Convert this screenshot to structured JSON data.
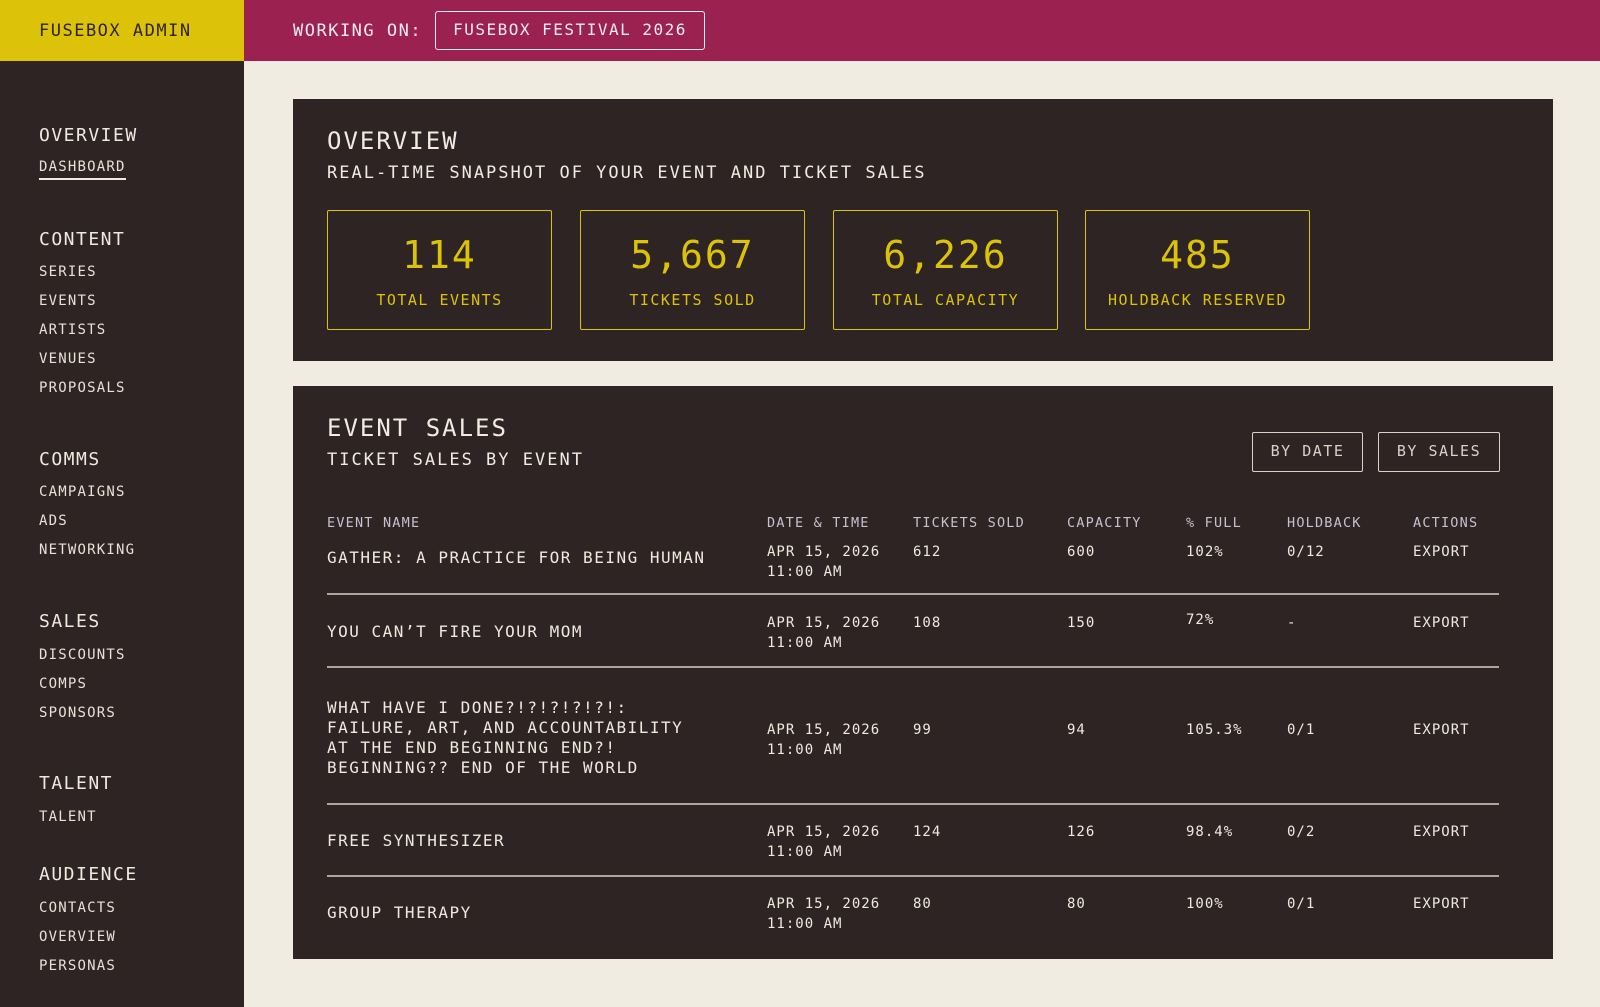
{
  "app": {
    "brand": "FUSEBOX ADMIN"
  },
  "topbar": {
    "working_on_label": "WORKING ON:",
    "working_on_value": "FUSEBOX FESTIVAL 2026"
  },
  "sidebar": {
    "sections": [
      {
        "heading": "OVERVIEW",
        "items": [
          "DASHBOARD"
        ]
      },
      {
        "heading": "CONTENT",
        "items": [
          "SERIES",
          "EVENTS",
          "ARTISTS",
          "VENUES",
          "PROPOSALS"
        ]
      },
      {
        "heading": "COMMS",
        "items": [
          "CAMPAIGNS",
          "ADS",
          "NETWORKING"
        ]
      },
      {
        "heading": "SALES",
        "items": [
          "DISCOUNTS",
          "COMPS",
          "SPONSORS"
        ]
      },
      {
        "heading": "TALENT",
        "items": [
          "TALENT"
        ]
      },
      {
        "heading": "AUDIENCE",
        "items": [
          "CONTACTS",
          "OVERVIEW",
          "PERSONAS"
        ]
      }
    ],
    "active_item": "DASHBOARD"
  },
  "overview": {
    "title": "OVERVIEW",
    "subtitle": "REAL-TIME SNAPSHOT OF YOUR EVENT AND TICKET SALES",
    "stats": [
      {
        "value": "114",
        "label": "TOTAL EVENTS"
      },
      {
        "value": "5,667",
        "label": "TICKETS SOLD"
      },
      {
        "value": "6,226",
        "label": "TOTAL CAPACITY"
      },
      {
        "value": "485",
        "label": "HOLDBACK RESERVED"
      }
    ]
  },
  "event_sales": {
    "title": "EVENT SALES",
    "subtitle": "TICKET SALES BY EVENT",
    "sort_by_date": "BY DATE",
    "sort_by_sales": "BY SALES",
    "columns": [
      "EVENT NAME",
      "DATE & TIME",
      "TICKETS SOLD",
      "CAPACITY",
      "% FULL",
      "HOLDBACK",
      "ACTIONS"
    ],
    "rows": [
      {
        "name": "GATHER: A PRACTICE FOR BEING HUMAN",
        "date": "APR 15, 2026\n11:00 AM",
        "sold": "612",
        "capacity": "600",
        "full": "102%",
        "holdback": "0/12",
        "action": "EXPORT"
      },
      {
        "name": "YOU CAN’T FIRE YOUR MOM",
        "date": "APR 15, 2026\n11:00 AM",
        "sold": "108",
        "capacity": "150",
        "full": "72%",
        "holdback": "-",
        "action": "EXPORT"
      },
      {
        "name": "WHAT HAVE I DONE?!?!?!?!?!:\nFAILURE, ART, AND ACCOUNTABILITY\nAT THE END BEGINNING END?!\nBEGINNING?? END OF THE WORLD",
        "date": "APR 15, 2026\n11:00 AM",
        "sold": "99",
        "capacity": "94",
        "full": "105.3%",
        "holdback": "0/1",
        "action": "EXPORT"
      },
      {
        "name": "FREE SYNTHESIZER",
        "date": "APR 15, 2026\n11:00 AM",
        "sold": "124",
        "capacity": "126",
        "full": "98.4%",
        "holdback": "0/2",
        "action": "EXPORT"
      },
      {
        "name": "GROUP THERAPY",
        "date": "APR 15, 2026\n11:00 AM",
        "sold": "80",
        "capacity": "80",
        "full": "100%",
        "holdback": "0/1",
        "action": "EXPORT"
      }
    ]
  }
}
